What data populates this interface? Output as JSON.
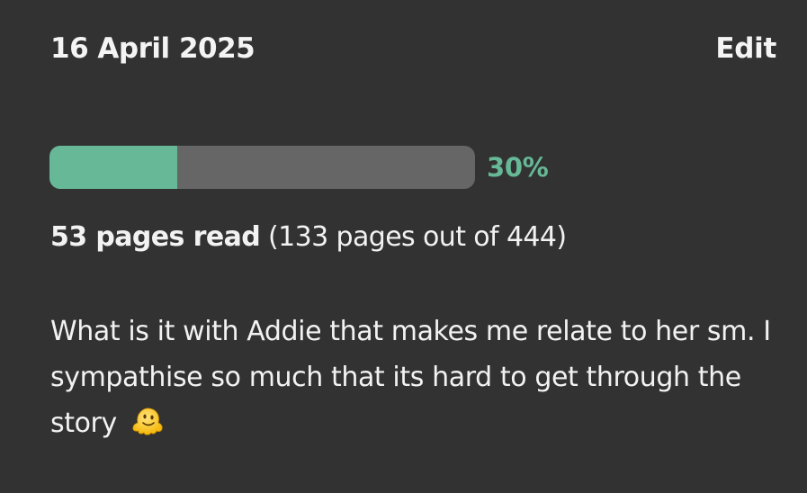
{
  "entry": {
    "date": "16 April 2025",
    "edit_label": "Edit",
    "progress": {
      "percent_value": 30,
      "percent_label": "30%"
    },
    "pages_read_label": "53 pages read",
    "pages_detail": "(133 pages out of 444)",
    "note": "What is it with Addie that makes me relate to her sm. I sympathise so much that its hard to get through the story",
    "note_emoji": "melting-face-emoji"
  },
  "colors": {
    "background": "#323232",
    "accent": "#66b896",
    "track": "#666666",
    "text": "#f2f2f2"
  }
}
